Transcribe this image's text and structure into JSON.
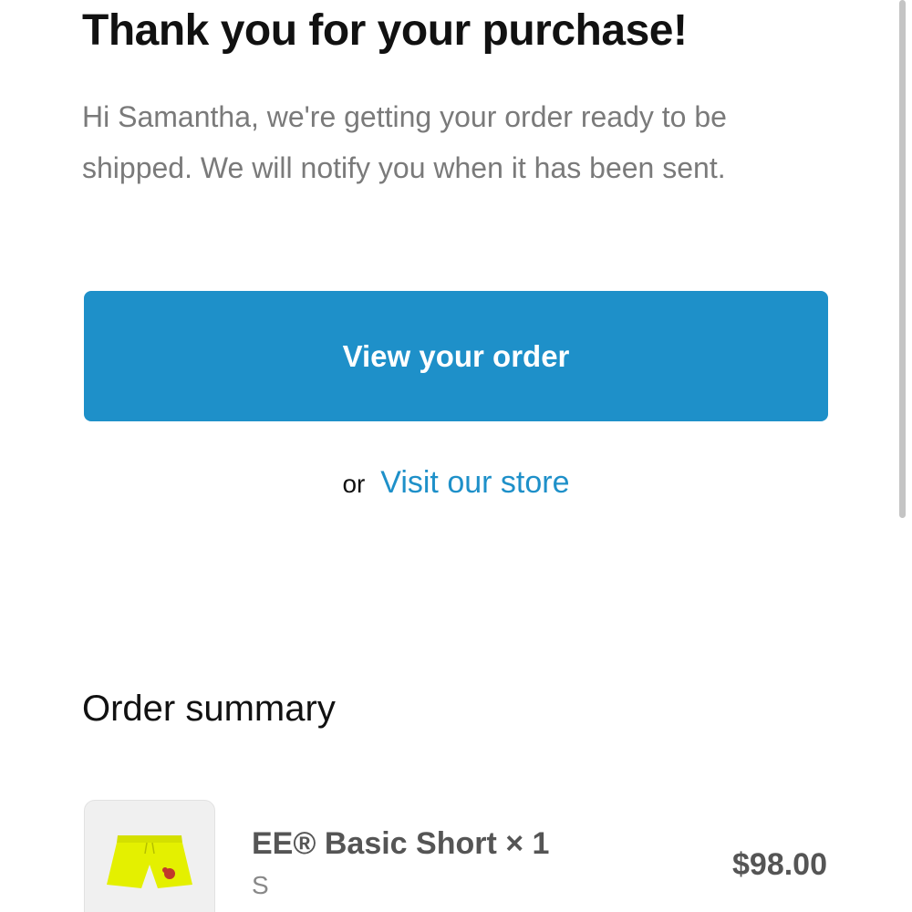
{
  "confirmation": {
    "title": "Thank you for your purchase!",
    "message": "Hi Samantha, we're getting your order ready to be shipped. We will notify you when it has been sent.",
    "primary_button_label": "View your order",
    "or_text": "or",
    "store_link_label": "Visit our store"
  },
  "order_summary": {
    "heading": "Order summary",
    "items": [
      {
        "name": "EE® Basic Short × 1",
        "variant": "S",
        "price": "$98.00",
        "thumbnail_icon": "shorts-product-image"
      }
    ]
  },
  "colors": {
    "accent": "#1e90c9",
    "product_shorts": "#e4f000",
    "product_logo": "#c0392b"
  }
}
